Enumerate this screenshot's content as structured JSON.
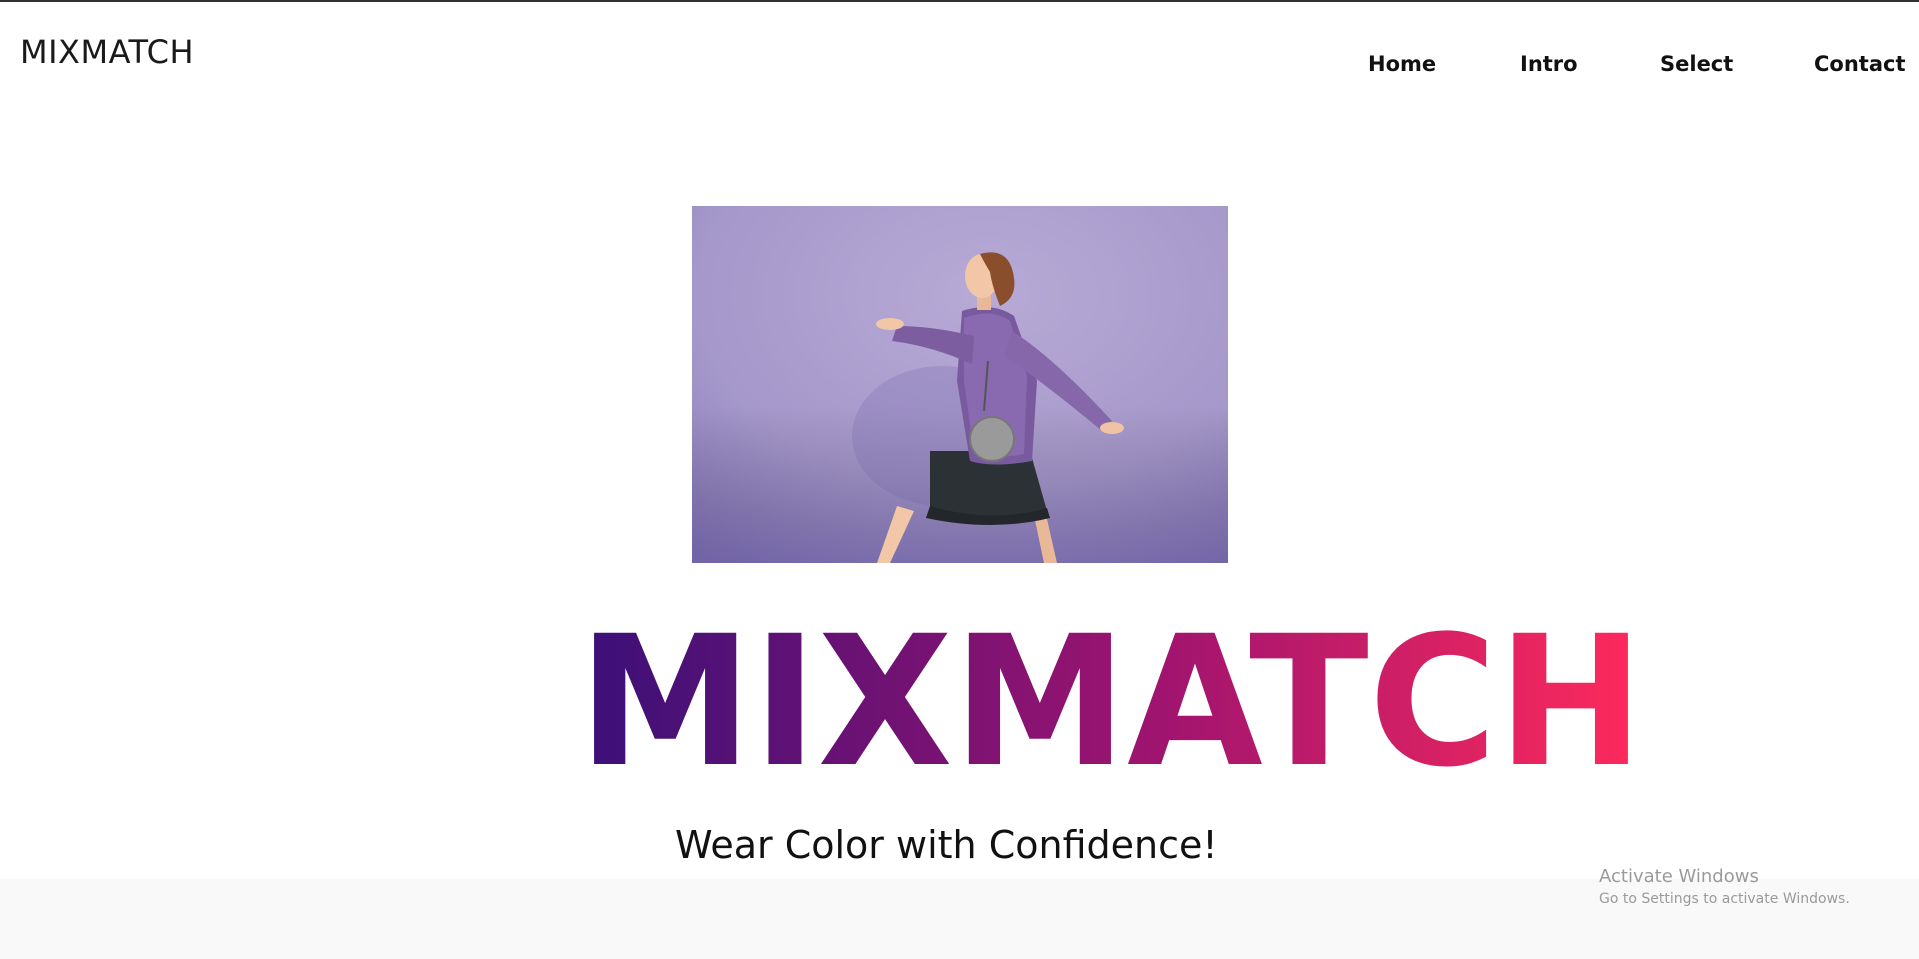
{
  "header": {
    "brand": "MIXMATCH",
    "nav": [
      {
        "label": "Home"
      },
      {
        "label": "Intro"
      },
      {
        "label": "Select"
      },
      {
        "label": "Contact"
      }
    ]
  },
  "hero": {
    "image_label": "woman in purple faux-fur coat walking against lavender backdrop",
    "title": "MIXMATCH",
    "tagline": "Wear Color with Confidence!"
  },
  "colors": {
    "title_gradient_start": "#3a1078",
    "title_gradient_mid": "#a0146f",
    "title_gradient_end": "#ff2a5c",
    "image_background": "#a99dcc"
  },
  "os_watermark": {
    "title": "Activate Windows",
    "subtitle": "Go to Settings to activate Windows."
  }
}
